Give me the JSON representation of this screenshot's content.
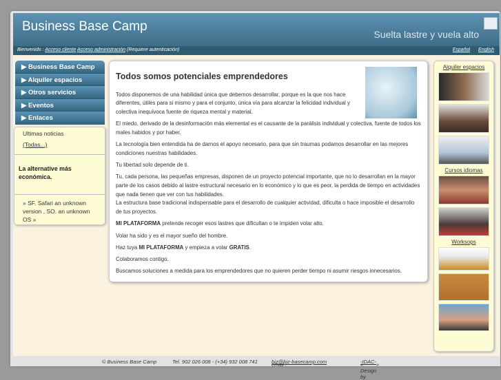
{
  "header": {
    "title": "Business Base Camp",
    "slogan": "Suelta lastre y vuela alto"
  },
  "nav": {
    "welcome": "Bienvenido :",
    "client": "Acceso cliente",
    "admin": "Acceso administración",
    "note": "(Requiere autenticación)",
    "lang": [
      "Español",
      "English"
    ]
  },
  "menu": [
    "Business Base Camp",
    "Alquiler espacios",
    "Otros servicios",
    "Eventos",
    "Enlaces"
  ],
  "news": {
    "title": "Ultimas noticias",
    "all": "(Todas...)",
    "headline": "La alternative más económica.",
    "browser": "» SF. Safari an unknown version , SO. an unknown OS »"
  },
  "main": {
    "title": "Todos somos potenciales emprendedores",
    "p1": "Todos disponemos de una habilidad única que debemos desarrollar, porque es la que nos hace diferentes, útiles para si mismo y para el conjunto, única vía para alcanzar la felicidad individual y colectiva inequívoca fuente de riqueza mental y material.",
    "p2": "El miedo, derivado de la desinformación más elemental es el causante de la parálisis individual y colectiva, fuente de todos los males habidos y por haber.",
    "p3": "La tecnología bien entendida ha de darnos el apoyo necesario, para que sin traumas podamos desarrollar en las mejores condiciones nuestras habilidades.",
    "p4": "Tu libertad solo depende de ti.",
    "p5a": "Tu, cada persona, las pequeñas empresas, disponen de un proyecto potencial importante, que no lo desarrollan en la mayor parte de los casos debido al lastre estructural necesario en lo económico y lo que es peor, la perdida de tiempo en actividades que nada tienen que ver con tus habilidades.",
    "p5b": "La estructura base tradicional indispensable para el desarrollo de cualquier actividad, dificulta o hace imposible el desarrollo de tus proyectos.",
    "brand": "MI PLATAFORMA",
    "p6": " pretende recoger esos lastres que dificultan o te impiden volar alto.",
    "p7": "Volar ha sido y es el mayor sueño del hombre.",
    "p8a": "Haz tuya ",
    "p8b": " y empieza a volar ",
    "gratis": "GRATIS",
    "p8c": ".",
    "p9": "Colaboramos contigo.",
    "p10": "Buscamos soluciones a medida para los emprendedores que no quieren perder tiempo ni asumir riesgos innecesarios."
  },
  "right": {
    "alquiler": "Alquiler espacios",
    "cursos": "Cursos idiomas",
    "workshops": "Worksops"
  },
  "footer": {
    "copy": "© Business Base Camp",
    "tel": "Tel. 902 026 008 - (+34) 932 008 741",
    "email_label": "email :",
    "email": "biz@biz-basecamp.com",
    "design": "« Design by ",
    "designer": "-IDAC-",
    "design_end": "»"
  }
}
